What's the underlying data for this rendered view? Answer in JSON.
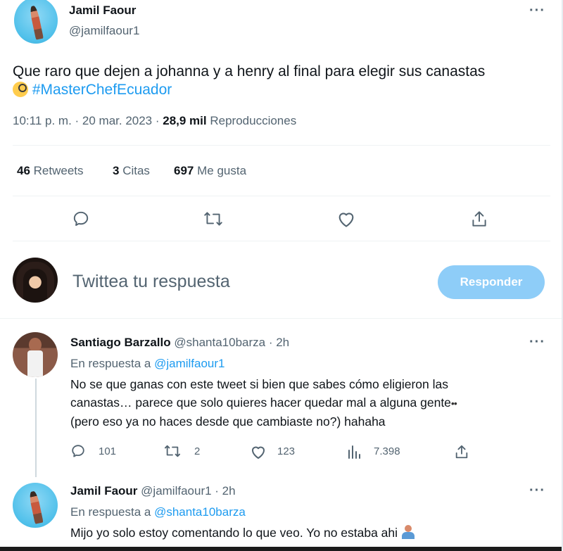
{
  "main_tweet": {
    "author_name": "Jamil Faour",
    "author_handle": "@jamilfaour1",
    "text_line1": "Que raro que dejen a johanna y a henry al final para elegir sus canastas",
    "emoji": "face-with-monocle",
    "hashtag": "#MasterChefEcuador",
    "time": "10:11 p. m. · 20 mar. 2023 · ",
    "views_count": "28,9 mil",
    "views_label": "Reproducciones",
    "retweets_count": "46",
    "retweets_label": "Retweets",
    "quotes_count": "3",
    "quotes_label": "Citas",
    "likes_count": "697",
    "likes_label": "Me gusta",
    "more_label": "···"
  },
  "compose": {
    "placeholder": "Twittea tu respuesta",
    "reply_button": "Responder"
  },
  "replies": [
    {
      "author_name": "Santiago Barzallo",
      "author_handle": "@shanta10barza · 2h",
      "in_reply_prefix": "En respuesta a ",
      "in_reply_to": "@jamilfaour1",
      "text_line1": "No se que ganas con este tweet si bien que sabes cómo eligieron las",
      "text_line2": "canastas… parece que solo quieres hacer quedar mal a alguna gente",
      "eyes_emoji": "••",
      "text_line3": "(pero eso ya no haces desde que cambiaste no?) hahaha",
      "reply_count": "101",
      "retweet_count": "2",
      "like_count": "123",
      "view_count": "7.398",
      "more_label": "···"
    },
    {
      "author_name": "Jamil Faour",
      "author_handle": "@jamilfaour1 · 2h",
      "in_reply_prefix": "En respuesta a ",
      "in_reply_to": "@shanta10barza",
      "text_line1": "Mijo yo solo estoy comentando lo que veo. Yo no estaba ahi",
      "emoji": "person-shrugging",
      "more_label": "···"
    }
  ],
  "colors": {
    "accent": "#1d9bf0",
    "reply_button_disabled": "#8ecdf8",
    "muted_text": "#536471",
    "divider": "#eff3f4"
  }
}
